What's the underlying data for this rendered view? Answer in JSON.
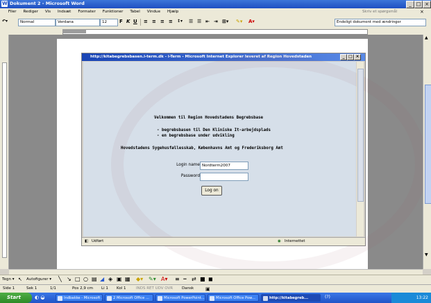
{
  "word": {
    "title": "Dokument 2 - Microsoft Word",
    "menu": [
      "Filer",
      "Rediger",
      "Vis",
      "Indsæt",
      "Formater",
      "Funktioner",
      "Tabel",
      "Vindue",
      "Hjælp"
    ],
    "help_placeholder": "Skriv et spørgsmål",
    "style": "Normal",
    "font": "Verdana",
    "size": "12",
    "final_view": "Endeligt dokument med ændringer"
  },
  "ie": {
    "title": "http://kitabegrebsbasen.i-term.dk - i-Term - Microsoft Internet Explorer leveret af Region Hovedstaden",
    "welcome": "Velkommen til Region Hovedstadens Begrebsbase",
    "bullets": [
      "- begrebsbasen til Den Kliniske It-arbejdsplads",
      "- en begrebsbase under udvikling"
    ],
    "org": "Hovedstadens Sygehusfællesskab, Københavns Amt og Frederiksborg Amt",
    "login_label": "Login name",
    "login_value": "Nordterm2007",
    "password_label": "Password",
    "password_value": "",
    "login_button": "Log on",
    "status_left": "Udført",
    "status_right": "Internettet"
  },
  "drawbar": {
    "draw": "Tegn ▾",
    "autoshapes": "Autofigurer ▾"
  },
  "status": {
    "page": "Side 1",
    "section": "Sek 1",
    "pages": "1/1",
    "pos": "Pos 2,9 cm",
    "line": "Li 1",
    "col": "Kol 1",
    "modes": "INDS  RET  UDV  OVR",
    "lang": "Dansk"
  },
  "taskbar": {
    "start": "Start",
    "tasks": [
      "Indbakke - Microsoft ...",
      "2 Microsoft Office ...",
      "Microsoft PowerPoint...",
      "Microsoft Office Pow...",
      "http://kitabegreb..."
    ],
    "clock": "13:22"
  }
}
